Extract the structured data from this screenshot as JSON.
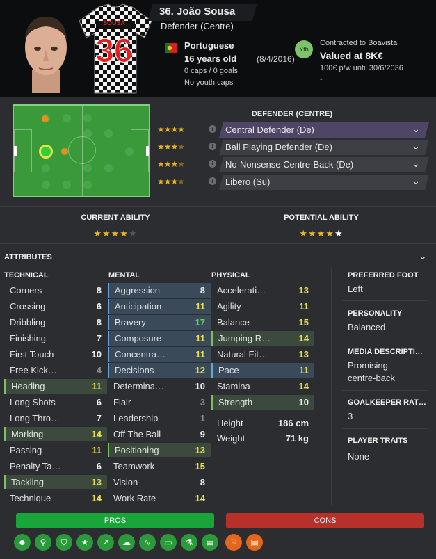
{
  "player": {
    "name": "36. João Sousa",
    "position": "Defender (Centre)",
    "nationality": "Portuguese",
    "age": "16 years old",
    "dob": "(8/4/2016)",
    "caps": "0 caps / 0 goals",
    "youth_caps": "No youth caps",
    "shirt_name": "SOUSA",
    "shirt_number": "36",
    "contract": "Contracted to Boavista",
    "value": "Valued at 8K€",
    "wage": "100€ p/w until 30/6/2036",
    "extra": "-",
    "badge": "Yth"
  },
  "roles": {
    "title": "DEFENDER (CENTRE)",
    "items": [
      {
        "label": "Central Defender (De)",
        "stars": 4,
        "selected": true
      },
      {
        "label": "Ball Playing Defender (De)",
        "stars": 3.5,
        "selected": false
      },
      {
        "label": "No-Nonsense Centre-Back (De)",
        "stars": 3.5,
        "selected": false
      },
      {
        "label": "Libero (Su)",
        "stars": 3.5,
        "selected": false
      }
    ]
  },
  "ability": {
    "current_title": "CURRENT ABILITY",
    "potential_title": "POTENTIAL ABILITY",
    "current_stars": 4,
    "potential_stars": 4.5
  },
  "attributes": {
    "title": "ATTRIBUTES",
    "technical_title": "TECHNICAL",
    "mental_title": "MENTAL",
    "physical_title": "PHYSICAL",
    "technical": [
      {
        "label": "Corners",
        "value": "8",
        "hl": "",
        "c": "v-w"
      },
      {
        "label": "Crossing",
        "value": "6",
        "hl": "",
        "c": "v-w"
      },
      {
        "label": "Dribbling",
        "value": "8",
        "hl": "",
        "c": "v-w"
      },
      {
        "label": "Finishing",
        "value": "7",
        "hl": "",
        "c": "v-w"
      },
      {
        "label": "First Touch",
        "value": "10",
        "hl": "",
        "c": "v-w"
      },
      {
        "label": "Free Kick…",
        "value": "4",
        "hl": "",
        "c": "v-gray"
      },
      {
        "label": "Heading",
        "value": "11",
        "hl": "g",
        "c": "v-y"
      },
      {
        "label": "Long Shots",
        "value": "6",
        "hl": "",
        "c": "v-w"
      },
      {
        "label": "Long Thro…",
        "value": "7",
        "hl": "",
        "c": "v-w"
      },
      {
        "label": "Marking",
        "value": "14",
        "hl": "g",
        "c": "v-y"
      },
      {
        "label": "Passing",
        "value": "11",
        "hl": "",
        "c": "v-y"
      },
      {
        "label": "Penalty Ta…",
        "value": "6",
        "hl": "",
        "c": "v-w"
      },
      {
        "label": "Tackling",
        "value": "13",
        "hl": "g",
        "c": "v-y"
      },
      {
        "label": "Technique",
        "value": "14",
        "hl": "",
        "c": "v-y"
      }
    ],
    "mental": [
      {
        "label": "Aggression",
        "value": "8",
        "hl": "b",
        "c": "v-w"
      },
      {
        "label": "Anticipation",
        "value": "11",
        "hl": "b",
        "c": "v-y"
      },
      {
        "label": "Bravery",
        "value": "17",
        "hl": "b",
        "c": "v-g"
      },
      {
        "label": "Composure",
        "value": "11",
        "hl": "b",
        "c": "v-y"
      },
      {
        "label": "Concentra…",
        "value": "11",
        "hl": "b",
        "c": "v-y"
      },
      {
        "label": "Decisions",
        "value": "12",
        "hl": "b",
        "c": "v-y"
      },
      {
        "label": "Determina…",
        "value": "10",
        "hl": "",
        "c": "v-w"
      },
      {
        "label": "Flair",
        "value": "3",
        "hl": "",
        "c": "v-gray"
      },
      {
        "label": "Leadership",
        "value": "1",
        "hl": "",
        "c": "v-gray"
      },
      {
        "label": "Off The Ball",
        "value": "9",
        "hl": "",
        "c": "v-w"
      },
      {
        "label": "Positioning",
        "value": "13",
        "hl": "g",
        "c": "v-y"
      },
      {
        "label": "Teamwork",
        "value": "15",
        "hl": "",
        "c": "v-y"
      },
      {
        "label": "Vision",
        "value": "8",
        "hl": "",
        "c": "v-w"
      },
      {
        "label": "Work Rate",
        "value": "14",
        "hl": "",
        "c": "v-y"
      }
    ],
    "physical": [
      {
        "label": "Accelerati…",
        "value": "13",
        "hl": "",
        "c": "v-y"
      },
      {
        "label": "Agility",
        "value": "11",
        "hl": "",
        "c": "v-y"
      },
      {
        "label": "Balance",
        "value": "15",
        "hl": "",
        "c": "v-y"
      },
      {
        "label": "Jumping R…",
        "value": "14",
        "hl": "g",
        "c": "v-y"
      },
      {
        "label": "Natural Fit…",
        "value": "13",
        "hl": "",
        "c": "v-y"
      },
      {
        "label": "Pace",
        "value": "11",
        "hl": "b",
        "c": "v-y"
      },
      {
        "label": "Stamina",
        "value": "14",
        "hl": "",
        "c": "v-y"
      },
      {
        "label": "Strength",
        "value": "10",
        "hl": "g",
        "c": "v-w"
      }
    ],
    "height_label": "Height",
    "height_value": "186 cm",
    "weight_label": "Weight",
    "weight_value": "71 kg"
  },
  "side": {
    "foot_title": "PREFERRED FOOT",
    "foot": "Left",
    "personality_title": "PERSONALITY",
    "personality": "Balanced",
    "media_title": "MEDIA DESCRIPTI…",
    "media_line1": "Promising",
    "media_line2": "centre-back",
    "gk_title": "GOALKEEPER RAT…",
    "gk": "3",
    "traits_title": "PLAYER TRAITS",
    "traits": "None"
  },
  "proscons": {
    "pros_label": "PROS",
    "cons_label": "CONS"
  },
  "colors": {
    "accent_yellow": "#e9e04a",
    "accent_green": "#5cd65c",
    "pros": "#1aa53a",
    "cons": "#b8302a",
    "star": "#e8b524"
  }
}
